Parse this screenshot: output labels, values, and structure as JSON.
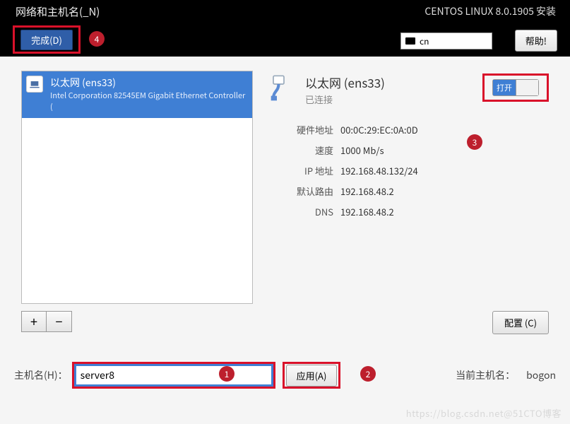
{
  "header": {
    "title": "网络和主机名(_N)",
    "right_title": "CENTOS LINUX 8.0.1905 安装",
    "done_label": "完成(D)",
    "lang": "cn",
    "help_label": "帮助!"
  },
  "list": {
    "item": {
      "title": "以太网 (ens33)",
      "subtitle": "Intel Corporation 82545EM Gigabit Ethernet Controller ("
    },
    "plus": "+",
    "minus": "−"
  },
  "details": {
    "title": "以太网 (ens33)",
    "status": "已连接",
    "toggle_on_label": "打开",
    "rows": {
      "hw_label": "硬件地址",
      "hw_value": "00:0C:29:EC:0A:0D",
      "speed_label": "速度",
      "speed_value": "1000 Mb/s",
      "ip_label": "IP 地址",
      "ip_value": "192.168.48.132/24",
      "gw_label": "默认路由",
      "gw_value": "192.168.48.2",
      "dns_label": "DNS",
      "dns_value": "192.168.48.2"
    },
    "config_label": "配置 (C)"
  },
  "host": {
    "label": "主机名(H)：",
    "input_value": "server8",
    "apply_label": "应用(A)",
    "current_label": "当前主机名：",
    "current_value": "bogon"
  },
  "badges": {
    "b1": "1",
    "b2": "2",
    "b3": "3",
    "b4": "4"
  },
  "watermark": "https://blog.csdn.net@51CTO博客"
}
